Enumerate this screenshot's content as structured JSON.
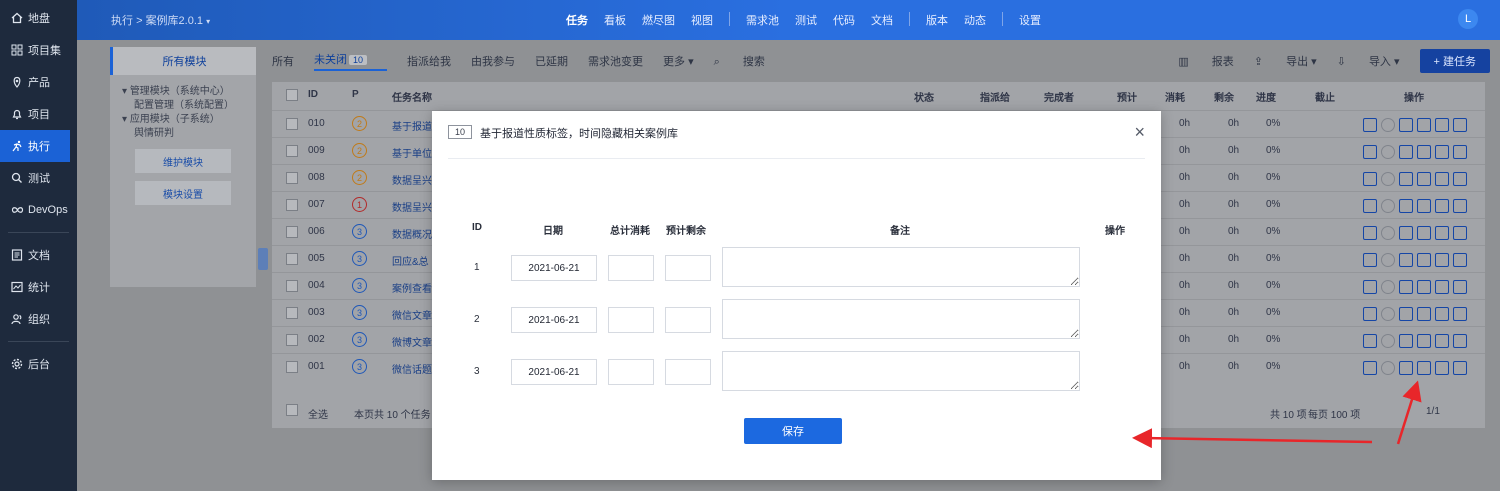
{
  "nav": {
    "items": [
      {
        "label": "地盘",
        "icon": "home-icon"
      },
      {
        "label": "项目集",
        "icon": "grid-icon"
      },
      {
        "label": "产品",
        "icon": "location-icon"
      },
      {
        "label": "项目",
        "icon": "bell-icon"
      },
      {
        "label": "执行",
        "icon": "run-icon"
      },
      {
        "label": "测试",
        "icon": "search-icon"
      },
      {
        "label": "DevOps",
        "icon": "infinity-icon"
      },
      {
        "label": "文档",
        "icon": "doc-icon"
      },
      {
        "label": "统计",
        "icon": "chart-icon"
      },
      {
        "label": "组织",
        "icon": "people-icon"
      },
      {
        "label": "后台",
        "icon": "gear-icon"
      }
    ]
  },
  "topbar": {
    "breadcrumb_exec": "执行",
    "breadcrumb_sep": ">",
    "breadcrumb_lib": "案例库2.0.1",
    "menu": [
      "任务",
      "看板",
      "燃尽图",
      "视图",
      "需求池",
      "测试",
      "代码",
      "文档",
      "版本",
      "动态",
      "设置"
    ],
    "avatar": "L"
  },
  "modules": {
    "all": "所有模块",
    "tree": [
      "管理模块（系统中心）",
      "配置管理（系统配置）",
      "应用模块（子系统）",
      "舆情研判"
    ],
    "maintain": "维护模块",
    "settings": "模块设置"
  },
  "tabs": {
    "all": "所有",
    "unclosed": "未关闭",
    "unclosed_count": "10",
    "assigned": "指派给我",
    "involved": "由我参与",
    "delayed": "已延期",
    "req_change": "需求池变更",
    "more": "更多",
    "search": "搜索",
    "report": "报表",
    "export": "导出",
    "import": "导入",
    "new_task": "+ 建任务"
  },
  "table": {
    "headers": [
      "ID",
      "P",
      "任务名称",
      "状态",
      "指派给",
      "完成者",
      "预计",
      "消耗",
      "剩余",
      "进度",
      "截止",
      "操作"
    ],
    "rows": [
      {
        "id": "010",
        "p": "2",
        "name": "基于报道",
        "used": "0h",
        "left": "0h",
        "progress": "0%"
      },
      {
        "id": "009",
        "p": "2",
        "name": "基于单位",
        "used": "0h",
        "left": "0h",
        "progress": "0%"
      },
      {
        "id": "008",
        "p": "2",
        "name": "数据呈兴",
        "used": "0h",
        "left": "0h",
        "progress": "0%"
      },
      {
        "id": "007",
        "p": "1",
        "name": "数据呈兴",
        "used": "0h",
        "left": "0h",
        "progress": "0%"
      },
      {
        "id": "006",
        "p": "3",
        "name": "数据概况",
        "used": "0h",
        "left": "0h",
        "progress": "0%"
      },
      {
        "id": "005",
        "p": "3",
        "name": "回应&总",
        "used": "0h",
        "left": "0h",
        "progress": "0%"
      },
      {
        "id": "004",
        "p": "3",
        "name": "案例查看",
        "used": "0h",
        "left": "0h",
        "progress": "0%"
      },
      {
        "id": "003",
        "p": "3",
        "name": "微信文章",
        "used": "0h",
        "left": "0h",
        "progress": "0%"
      },
      {
        "id": "002",
        "p": "3",
        "name": "微博文章",
        "used": "0h",
        "left": "0h",
        "progress": "0%"
      },
      {
        "id": "001",
        "p": "3",
        "name": "微信话题",
        "used": "0h",
        "left": "0h",
        "progress": "0%"
      }
    ],
    "select_all": "全选",
    "page_summary": "本页共 10 个任务",
    "total": "共 10 项",
    "per_page": "每页 100 项",
    "pages": "1/1"
  },
  "modal": {
    "id_badge": "10",
    "title": "基于报道性质标签，时间隐藏相关案例库",
    "close": "×",
    "col_id": "ID",
    "col_date": "日期",
    "col_total_used": "总计消耗",
    "col_est_left": "预计剩余",
    "col_note": "备注",
    "col_action": "操作",
    "entries": [
      {
        "id": "1",
        "date": "2021-06-21"
      },
      {
        "id": "2",
        "date": "2021-06-21"
      },
      {
        "id": "3",
        "date": "2021-06-21"
      }
    ],
    "save": "保存"
  },
  "colors": {
    "primary": "#1c69e0",
    "nav_bg": "#1e2a3d",
    "annotation_arrow": "#e8262a"
  }
}
